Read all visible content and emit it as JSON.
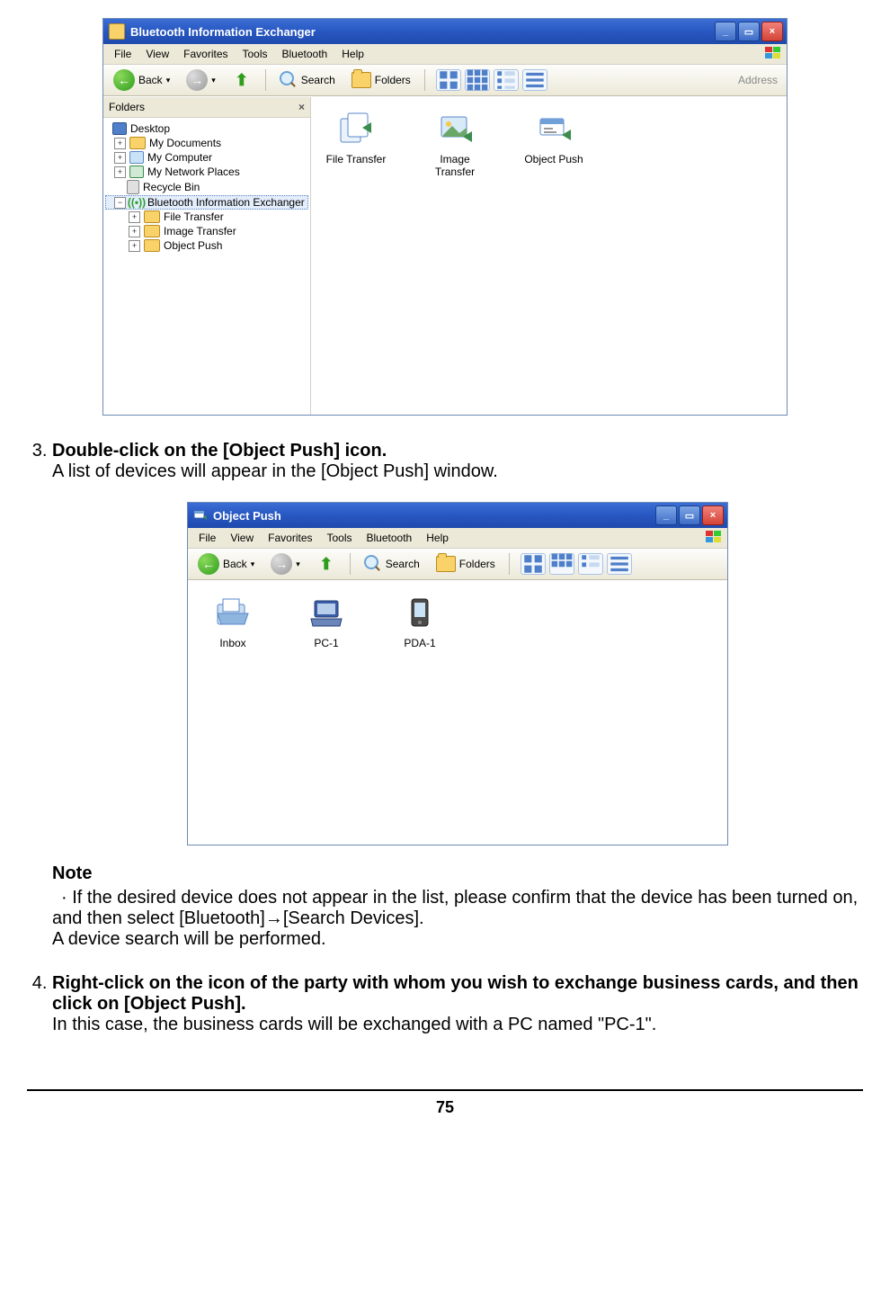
{
  "window1": {
    "title": "Bluetooth Information Exchanger",
    "menu": [
      "File",
      "View",
      "Favorites",
      "Tools",
      "Bluetooth",
      "Help"
    ],
    "toolbar": {
      "back": "Back",
      "search": "Search",
      "folders": "Folders",
      "address": "Address"
    },
    "foldersPane": {
      "header": "Folders",
      "tree": {
        "desktop": "Desktop",
        "mydocs": "My Documents",
        "mycomp": "My Computer",
        "netplaces": "My Network Places",
        "recycle": "Recycle Bin",
        "btex": "Bluetooth Information Exchanger",
        "ft": "File Transfer",
        "it": "Image Transfer",
        "op": "Object Push"
      }
    },
    "content": {
      "ft": "File Transfer",
      "it": "Image Transfer",
      "op": "Object Push"
    }
  },
  "step3": {
    "num": "3.",
    "title": "Double-click on the [Object Push] icon.",
    "desc": "A list of devices will appear in the [Object Push] window."
  },
  "window2": {
    "title": "Object Push",
    "menu": [
      "File",
      "View",
      "Favorites",
      "Tools",
      "Bluetooth",
      "Help"
    ],
    "toolbar": {
      "back": "Back",
      "search": "Search",
      "folders": "Folders"
    },
    "content": {
      "inbox": "Inbox",
      "pc1": "PC-1",
      "pda1": "PDA-1"
    }
  },
  "note": {
    "label": "Note",
    "body": "If the desired device does not appear in the list, please confirm that the device has been turned on, and then select [Bluetooth]→[Search Devices].",
    "body2": "A device search will be performed."
  },
  "step4": {
    "num": "4.",
    "title": "Right-click on the icon of the party with whom you wish to exchange business cards, and then click on [Object Push].",
    "desc": "In this case, the business cards will be exchanged with a PC named \"PC-1\"."
  },
  "pageNumber": "75"
}
